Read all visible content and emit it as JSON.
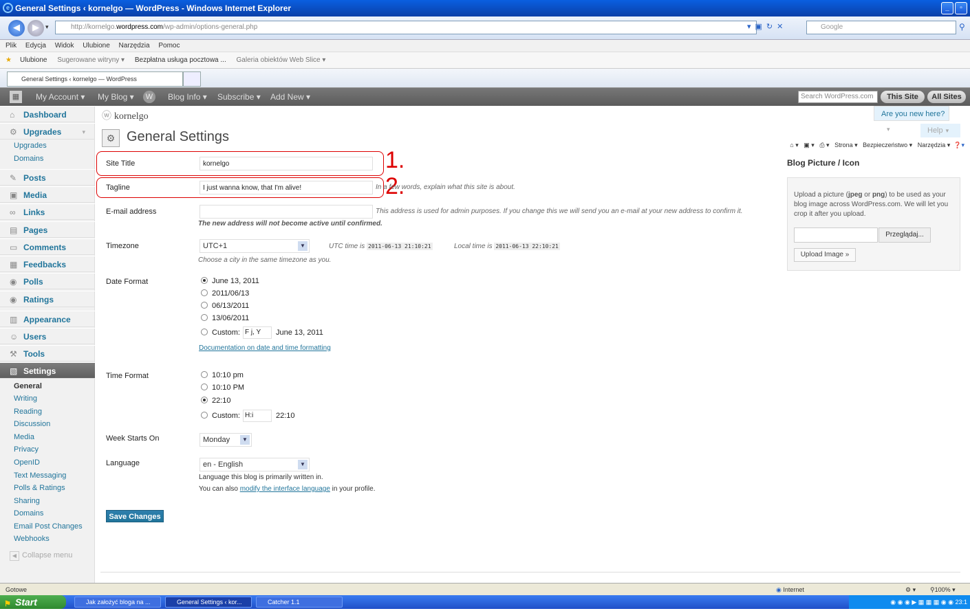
{
  "browser": {
    "window_title": "General Settings ‹ kornelgo — WordPress - Windows Internet Explorer",
    "url_prefix": "http://kornelgo.",
    "url_domain": "wordpress.com",
    "url_path": "/wp-admin/options-general.php",
    "search_placeholder": "Google",
    "menu": [
      "Plik",
      "Edycja",
      "Widok",
      "Ulubione",
      "Narzędzia",
      "Pomoc"
    ],
    "favorites": {
      "label": "Ulubione",
      "suggested": "Sugerowane witryny ▾",
      "mail": "Bezpłatna usługa pocztowa ...",
      "gallery": "Galeria obiektów Web Slice ▾"
    },
    "tab_title": "General Settings ‹ kornelgo — WordPress",
    "command_bar": [
      "Strona ▾",
      "Bezpieczeństwo ▾",
      "Narzędzia ▾"
    ]
  },
  "adminbar": {
    "my_account": "My Account ▾",
    "my_blog": "My Blog ▾",
    "blog_info": "Blog Info ▾",
    "subscribe": "Subscribe ▾",
    "add_new": "Add New ▾",
    "search_placeholder": "Search WordPress.com",
    "this_site": "This Site",
    "all_sites": "All Sites"
  },
  "sidebar": {
    "items": [
      {
        "label": "Dashboard",
        "icon": "⌂"
      },
      {
        "label": "Upgrades",
        "icon": "⚙"
      },
      {
        "label": "Posts",
        "icon": "✎"
      },
      {
        "label": "Media",
        "icon": "▣"
      },
      {
        "label": "Links",
        "icon": "∞"
      },
      {
        "label": "Pages",
        "icon": "▤"
      },
      {
        "label": "Comments",
        "icon": "▭"
      },
      {
        "label": "Feedbacks",
        "icon": "▦"
      },
      {
        "label": "Polls",
        "icon": "◉"
      },
      {
        "label": "Ratings",
        "icon": "◉"
      },
      {
        "label": "Appearance",
        "icon": "▥"
      },
      {
        "label": "Users",
        "icon": "☺"
      },
      {
        "label": "Tools",
        "icon": "⚒"
      },
      {
        "label": "Settings",
        "icon": "▧"
      }
    ],
    "upgrades_sub": [
      "Upgrades",
      "Domains"
    ],
    "settings_sub": [
      "General",
      "Writing",
      "Reading",
      "Discussion",
      "Media",
      "Privacy",
      "OpenID",
      "Text Messaging",
      "Polls & Ratings",
      "Sharing",
      "Domains",
      "Email Post Changes",
      "Webhooks"
    ],
    "collapse": "Collapse menu"
  },
  "page": {
    "site_name": "kornelgo",
    "new_here": "Are you new here?",
    "help": "Help",
    "title": "General Settings",
    "site_title_label": "Site Title",
    "site_title_value": "kornelgo",
    "tagline_label": "Tagline",
    "tagline_value": "I just wanna know, that I'm alive!",
    "tagline_desc": "In a few words, explain what this site is about.",
    "email_label": "E-mail address",
    "email_value": "",
    "email_desc": "This address is used for admin purposes. If you change this we will send you an e-mail at your new address to confirm it.",
    "email_desc_bold": "The new address will not become active until confirmed.",
    "timezone_label": "Timezone",
    "timezone_value": "UTC+1",
    "utc_label": "UTC time is",
    "utc_value": "2011-06-13 21:10:21",
    "local_label": "Local time is",
    "local_value": "2011-06-13 22:10:21",
    "timezone_desc": "Choose a city in the same timezone as you.",
    "date_format_label": "Date Format",
    "date_options": [
      "June 13, 2011",
      "2011/06/13",
      "06/13/2011",
      "13/06/2011"
    ],
    "date_custom_label": "Custom:",
    "date_custom_value": "F j, Y",
    "date_custom_preview": "June 13, 2011",
    "date_doc_link": "Documentation on date and time formatting",
    "time_format_label": "Time Format",
    "time_options": [
      "10:10 pm",
      "10:10 PM",
      "22:10"
    ],
    "time_custom_label": "Custom:",
    "time_custom_value": "H:i",
    "time_custom_preview": "22:10",
    "week_label": "Week Starts On",
    "week_value": "Monday",
    "language_label": "Language",
    "language_value": "en - English",
    "language_desc": "Language this blog is primarily written in.",
    "language_desc2_pre": "You can also",
    "language_link": "modify the interface language",
    "language_desc2_post": "in your profile.",
    "save": "Save Changes",
    "annotation_1": "1.",
    "annotation_2": "2."
  },
  "blog_picture": {
    "title": "Blog Picture / Icon",
    "text_pre": "Upload a picture (",
    "jpeg": "jpeg",
    "or": " or ",
    "png": "png",
    "text_post": ") to be used as your blog image across WordPress.com. We will let you crop it after you upload.",
    "browse": "Przeglądaj...",
    "upload": "Upload Image »"
  },
  "statusbar": {
    "left": "Gotowe",
    "zone": "Internet",
    "zoom": "100%"
  },
  "taskbar": {
    "start": "Start",
    "tasks": [
      "Jak założyć bloga na ...",
      "General Settings ‹ kor...",
      "Catcher 1.1"
    ],
    "clock": "23:1"
  }
}
